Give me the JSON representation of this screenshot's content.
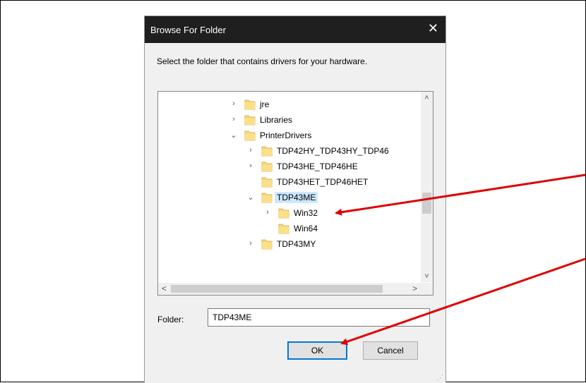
{
  "dialog": {
    "title": "Browse For Folder",
    "close_glyph": "✕",
    "instruction": "Select the folder that contains drivers for your hardware."
  },
  "tree": {
    "items": [
      {
        "label": "jre",
        "chevron": "›",
        "selected": false
      },
      {
        "label": "Libraries",
        "chevron": "›",
        "selected": false
      },
      {
        "label": "PrinterDrivers",
        "chevron": "⌄",
        "selected": false
      },
      {
        "label": "TDP42HY_TDP43HY_TDP46",
        "chevron": "›",
        "selected": false
      },
      {
        "label": "TDP43HE_TDP46HE",
        "chevron": "›",
        "selected": false
      },
      {
        "label": "TDP43HET_TDP46HET",
        "chevron": "",
        "selected": false
      },
      {
        "label": "TDP43ME",
        "chevron": "⌄",
        "selected": true
      },
      {
        "label": "Win32",
        "chevron": "›",
        "selected": false
      },
      {
        "label": "Win64",
        "chevron": "",
        "selected": false
      },
      {
        "label": "TDP43MY",
        "chevron": "›",
        "selected": false
      }
    ],
    "scroll_up": "˄",
    "scroll_down": "˅",
    "scroll_left": "<",
    "scroll_right": ">"
  },
  "folder": {
    "label": "Folder:",
    "value": "TDP43ME"
  },
  "buttons": {
    "ok": "OK",
    "cancel": "Cancel"
  },
  "colors": {
    "titlebar": "#1f1f1f",
    "selection": "#cce8ff",
    "folder_icon": "#f8d775",
    "annotation_arrow": "#e00000",
    "ok_border": "#0078d7"
  }
}
